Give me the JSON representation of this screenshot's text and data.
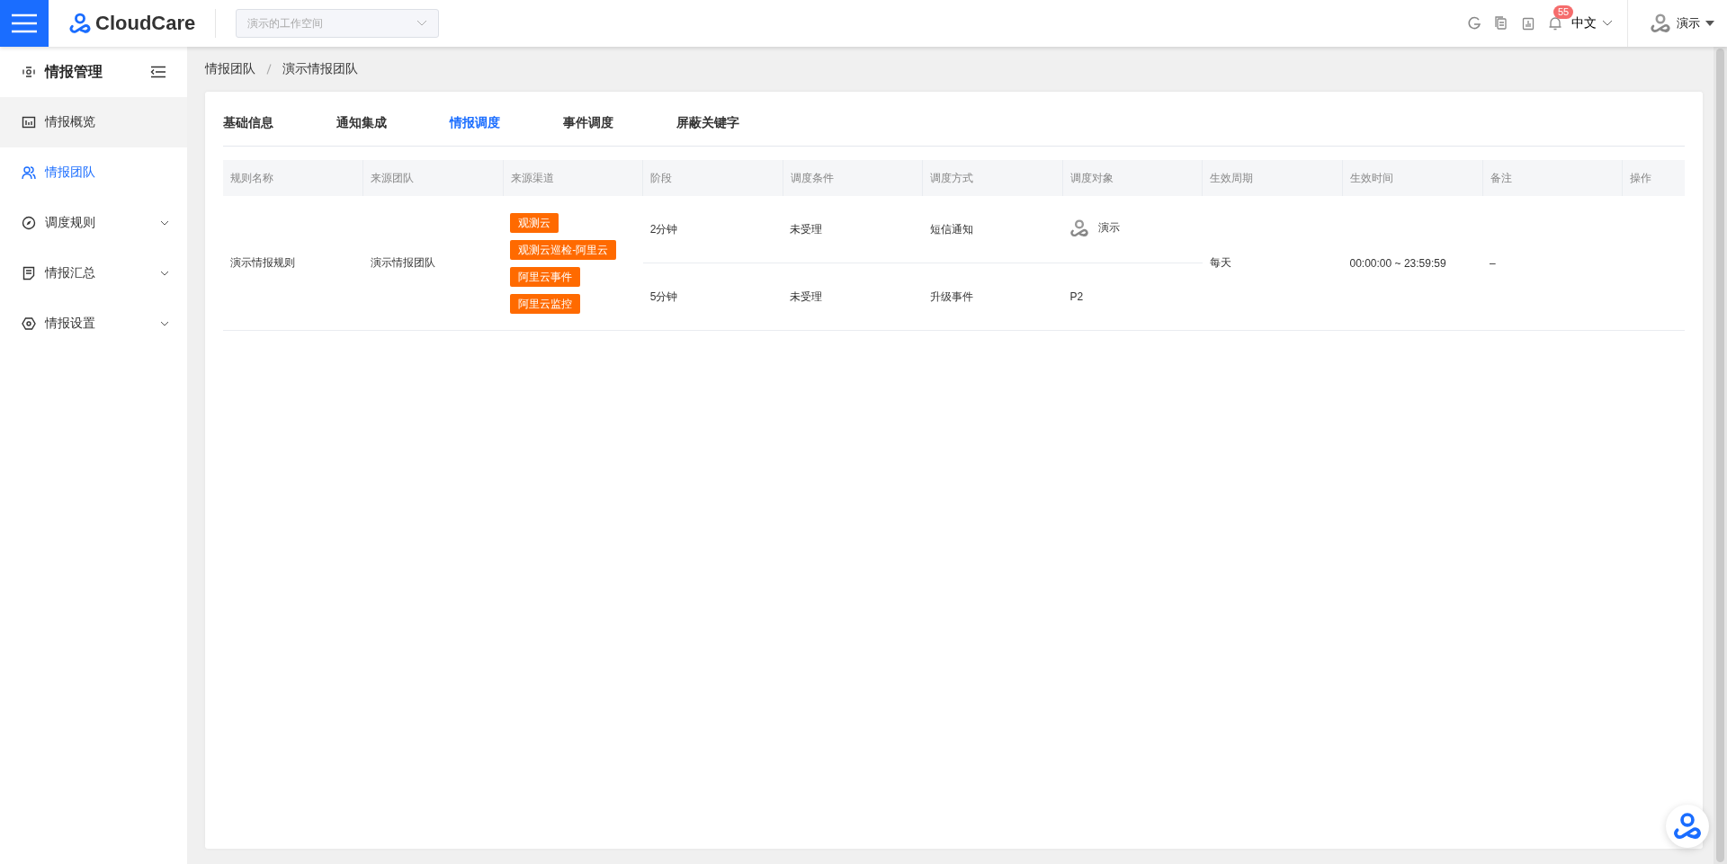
{
  "topbar": {
    "logo_text": "CloudCare",
    "workspace": {
      "value": "演示的工作空间"
    },
    "notification_count": "55",
    "language": "中文",
    "user": "演示"
  },
  "sidebar": {
    "title": "情报管理",
    "items": [
      {
        "label": "情报概览",
        "kind": "link",
        "selected": false,
        "hovered": true
      },
      {
        "label": "情报团队",
        "kind": "link",
        "selected": true,
        "hovered": false
      },
      {
        "label": "调度规则",
        "kind": "group",
        "selected": false,
        "hovered": false
      },
      {
        "label": "情报汇总",
        "kind": "group",
        "selected": false,
        "hovered": false
      },
      {
        "label": "情报设置",
        "kind": "group",
        "selected": false,
        "hovered": false
      }
    ]
  },
  "breadcrumb": [
    "情报团队",
    "演示情报团队"
  ],
  "tabs": [
    {
      "label": "基础信息",
      "selected": false
    },
    {
      "label": "通知集成",
      "selected": false
    },
    {
      "label": "情报调度",
      "selected": true
    },
    {
      "label": "事件调度",
      "selected": false
    },
    {
      "label": "屏蔽关键字",
      "selected": false
    }
  ],
  "table": {
    "columns": [
      "规则名称",
      "来源团队",
      "来源渠道",
      "阶段",
      "调度条件",
      "调度方式",
      "调度对象",
      "生效周期",
      "生效时间",
      "备注",
      "操作"
    ],
    "rows": [
      {
        "name": "演示情报规则",
        "team": "演示情报团队",
        "channels": [
          "观测云",
          "观测云巡检-阿里云",
          "阿里云事件",
          "阿里云监控"
        ],
        "stages": [
          {
            "stage": "2分钟",
            "condition": "未受理",
            "method": "短信通知",
            "target": {
              "kind": "user",
              "text": "演示"
            }
          },
          {
            "stage": "5分钟",
            "condition": "未受理",
            "method": "升级事件",
            "target": {
              "kind": "level",
              "text": "P2"
            }
          }
        ],
        "cycle": "每天",
        "time": "00:00:00 ~ 23:59:59",
        "note": "–"
      }
    ]
  }
}
